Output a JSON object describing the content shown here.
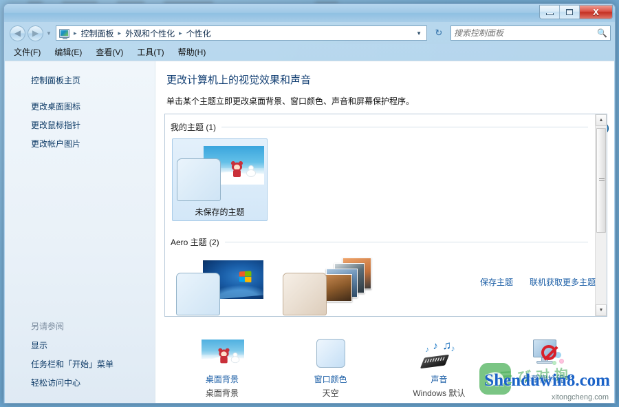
{
  "window": {
    "title": "",
    "controls": {
      "minimize": "–",
      "maximize": "□",
      "close": "X"
    }
  },
  "nav": {
    "back_icon": "◀",
    "forward_icon": "▶",
    "history_dropdown": "▼",
    "address_icon": "control-panel-icon",
    "breadcrumbs": [
      "控制面板",
      "外观和个性化",
      "个性化"
    ],
    "breadcrumb_separator": "▸",
    "address_dropdown": "▼",
    "refresh_icon": "↻"
  },
  "search": {
    "placeholder": "搜索控制面板",
    "value": "",
    "icon": "search-icon"
  },
  "menubar": {
    "items": [
      "文件(F)",
      "编辑(E)",
      "查看(V)",
      "工具(T)",
      "帮助(H)"
    ]
  },
  "sidebar": {
    "home": "控制面板主页",
    "links": [
      "更改桌面图标",
      "更改鼠标指针",
      "更改帐户图片"
    ],
    "see_also_heading": "另请参阅",
    "see_also": [
      "显示",
      "任务栏和「开始」菜单",
      "轻松访问中心"
    ]
  },
  "main": {
    "title": "更改计算机上的视觉效果和声音",
    "description": "单击某个主题立即更改桌面背景、窗口颜色、声音和屏幕保护程序。",
    "help_icon": "?",
    "groups": [
      {
        "heading": "我的主题 (1)",
        "themes": [
          {
            "label": "未保存的主题",
            "selected": true,
            "kind": "custom"
          }
        ]
      },
      {
        "heading": "Aero 主题 (2)",
        "themes": [
          {
            "label": "",
            "selected": false,
            "kind": "windows7"
          },
          {
            "label": "",
            "selected": false,
            "kind": "photos"
          }
        ]
      }
    ],
    "theme_links": [
      "保存主题",
      "联机获取更多主题"
    ],
    "scrollbar": {
      "up_arrow": "▲",
      "down_arrow": "▼"
    }
  },
  "settings_row": [
    {
      "label": "桌面背景",
      "value": "桌面背景",
      "icon": "desktop-background-icon"
    },
    {
      "label": "窗口颜色",
      "value": "天空",
      "icon": "window-color-icon"
    },
    {
      "label": "声音",
      "value": "Windows 默认",
      "icon": "sound-icon"
    },
    {
      "label": "屏幕保护程序",
      "value": "",
      "icon": "screensaver-icon"
    }
  ],
  "watermarks": {
    "green": "云 び 对 㧦",
    "blue": "Shenduwin8.com",
    "sub": "xitongcheng.com"
  }
}
